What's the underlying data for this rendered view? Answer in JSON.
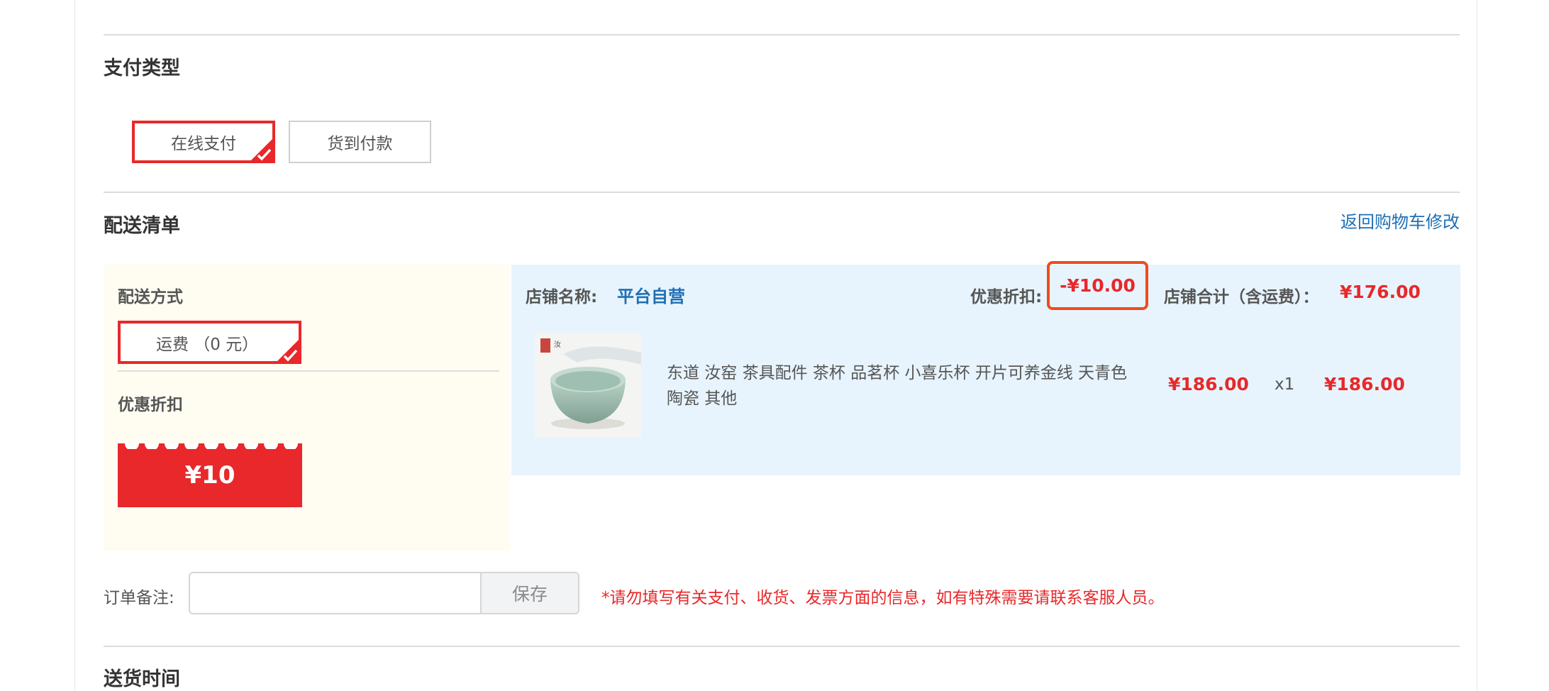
{
  "payment": {
    "title": "支付类型",
    "options": [
      {
        "label": "在线支付",
        "selected": true
      },
      {
        "label": "货到付款",
        "selected": false
      }
    ]
  },
  "delivery": {
    "title": "配送清单",
    "back_link": "返回购物车修改",
    "method_label": "配送方式",
    "shipping_option": "运费 （0 元）",
    "discount_label": "优惠折扣",
    "coupon_value": "¥10"
  },
  "store": {
    "name_label": "店铺名称:",
    "name": "平台自营",
    "discount_label": "优惠折扣:",
    "discount_value": "-¥10.00",
    "total_label": "店铺合计（含运费）：",
    "total_value": "¥176.00"
  },
  "product": {
    "title": "东道 汝窑 茶具配件 茶杯 品茗杯 小喜乐杯 开片可养金线 天青色 陶瓷 其他",
    "unit_price": "¥186.00",
    "quantity": "x1",
    "subtotal": "¥186.00",
    "image_icon": "celadon-teacup-image"
  },
  "remark": {
    "label": "订单备注:",
    "value": "",
    "save_label": "保存",
    "notice": "*请勿填写有关支付、收货、发票方面的信息，如有特殊需要请联系客服人员。"
  },
  "delivery_time": {
    "title": "送货时间"
  },
  "colors": {
    "accent_red": "#e8282a",
    "link_blue": "#1e6fb5",
    "highlight_orange": "#f04b1e"
  }
}
